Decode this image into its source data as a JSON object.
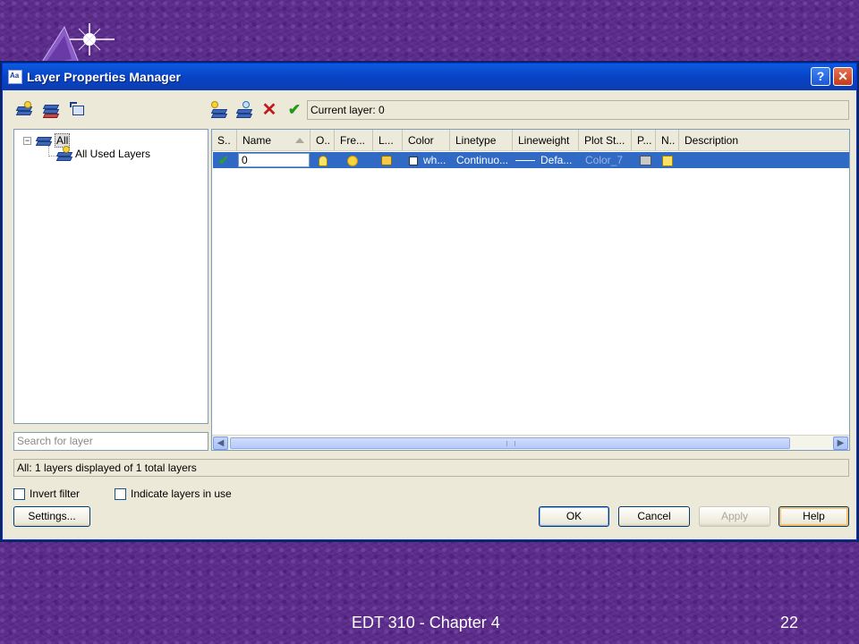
{
  "slide": {
    "footer_title": "EDT 310 - Chapter 4",
    "page_number": "22"
  },
  "dialog": {
    "title": "Layer Properties Manager",
    "help_glyph": "?",
    "close_glyph": "✕",
    "current_layer": "Current layer: 0"
  },
  "tree": {
    "root": "All",
    "child": "All Used Layers",
    "collapse_glyph": "−"
  },
  "search": {
    "placeholder": "Search for layer"
  },
  "grid": {
    "columns": [
      "S..",
      "Name",
      "O..",
      "Fre...",
      "L...",
      "Color",
      "Linetype",
      "Lineweight",
      "Plot St...",
      "P...",
      "N..",
      "Description"
    ],
    "row": {
      "status": "✔",
      "name": "0",
      "color": "wh...",
      "linetype": "Continuo...",
      "lineweight": "Defa...",
      "plot_style": "Color_7"
    }
  },
  "status": {
    "text": "All: 1 layers displayed of 1 total layers"
  },
  "options": {
    "invert_filter": "Invert filter",
    "indicate_layers": "Indicate layers in use"
  },
  "buttons": {
    "settings": "Settings...",
    "ok": "OK",
    "cancel": "Cancel",
    "apply": "Apply",
    "help": "Help"
  },
  "colors": {
    "slide_background": "#5c2e8a",
    "selection": "#316ac5",
    "titlebar": "#0843c6"
  }
}
